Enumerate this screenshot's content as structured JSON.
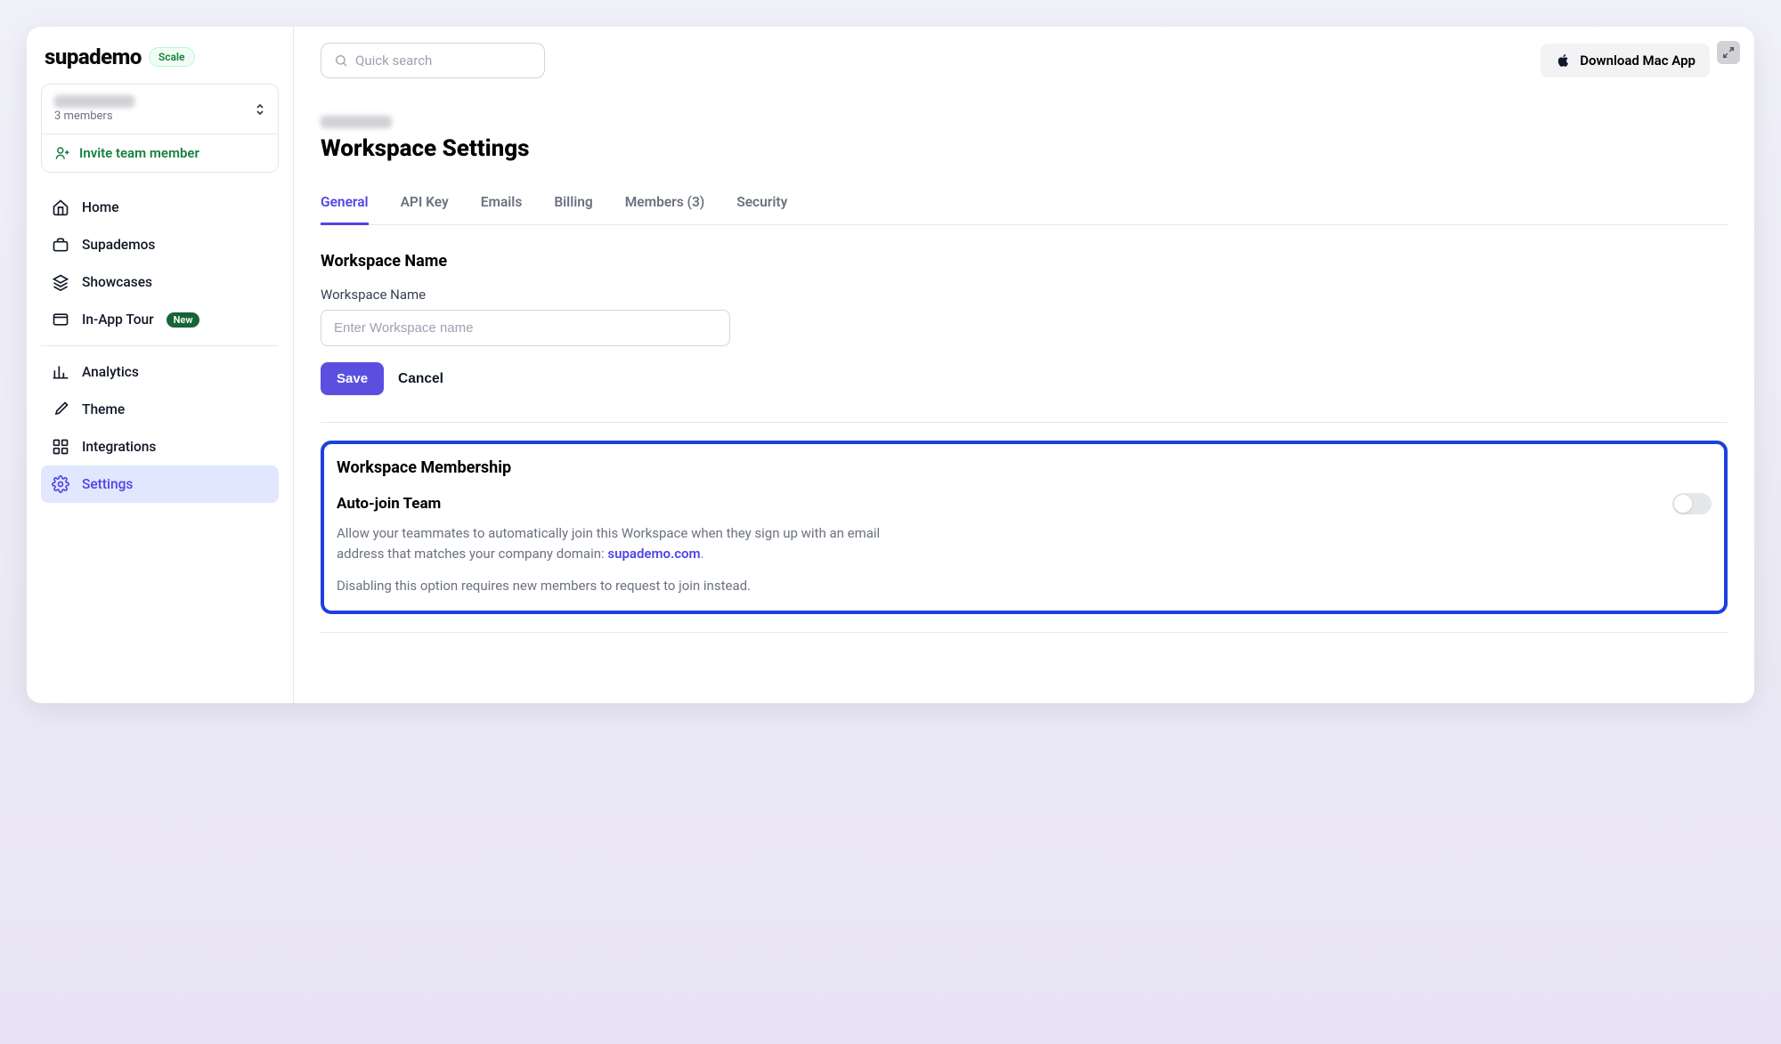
{
  "brand": {
    "name": "supademo",
    "plan_badge": "Scale"
  },
  "workspace": {
    "members_label": "3 members",
    "invite_label": "Invite team member"
  },
  "sidebar": {
    "items": [
      {
        "label": "Home"
      },
      {
        "label": "Supademos"
      },
      {
        "label": "Showcases"
      },
      {
        "label": "In-App Tour",
        "badge": "New"
      }
    ],
    "secondary": [
      {
        "label": "Analytics"
      },
      {
        "label": "Theme"
      },
      {
        "label": "Integrations"
      },
      {
        "label": "Settings"
      }
    ]
  },
  "header": {
    "search_placeholder": "Quick search",
    "download_label": "Download Mac App"
  },
  "page": {
    "title": "Workspace Settings",
    "tabs": [
      {
        "label": "General",
        "active": true
      },
      {
        "label": "API Key"
      },
      {
        "label": "Emails"
      },
      {
        "label": "Billing"
      },
      {
        "label": "Members (3)"
      },
      {
        "label": "Security"
      }
    ]
  },
  "workspace_name_section": {
    "title": "Workspace Name",
    "field_label": "Workspace Name",
    "placeholder": "Enter Workspace name",
    "value": "",
    "save": "Save",
    "cancel": "Cancel"
  },
  "membership": {
    "title": "Workspace Membership",
    "autojoin_title": "Auto-join Team",
    "toggle_on": false,
    "desc_part1": "Allow your teammates to automatically join this Workspace when they sign up with an email address that matches your company domain: ",
    "domain": "supademo.com",
    "desc_part2": "Disabling this option requires new members to request to join instead."
  }
}
